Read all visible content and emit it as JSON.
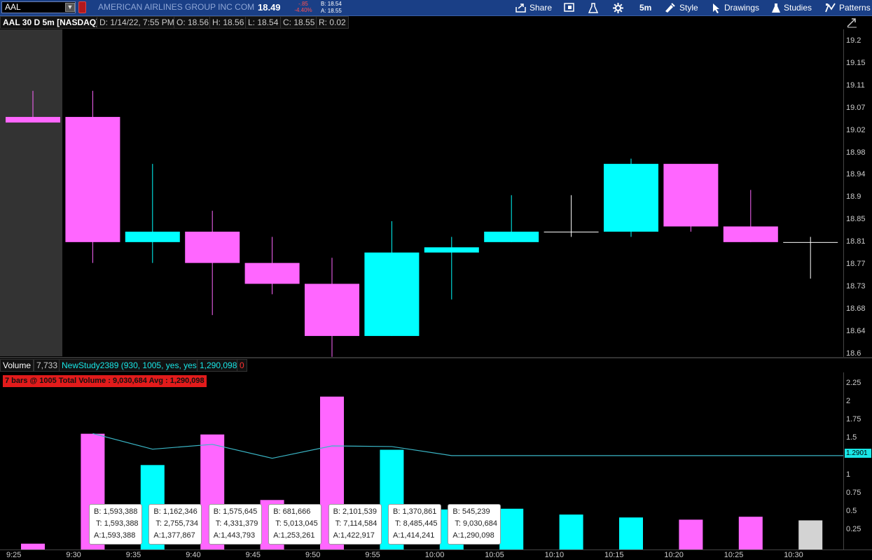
{
  "toolbar": {
    "symbol": "AAL",
    "company": "AMERICAN AIRLINES GROUP INC COM",
    "last": "18.49",
    "net_change": "-.85",
    "pct_change": "-4.40%",
    "bid": "B: 18.54",
    "ask": "A: 18.55",
    "share_label": "Share",
    "timeframe_label": "5m",
    "style_label": "Style",
    "drawings_label": "Drawings",
    "studies_label": "Studies",
    "patterns_label": "Patterns"
  },
  "header": {
    "title": "AAL 30 D 5m [NASDAQ]",
    "date": "D: 1/14/22, 7:55 PM",
    "open": "O: 18.56",
    "high": "H: 18.56",
    "low": "L: 18.54",
    "close": "C: 18.55",
    "range": "R: 0.02"
  },
  "volume_header": {
    "label": "Volume",
    "value": "7,733",
    "study": "NewStudy2389 (930, 1005, yes, yes)",
    "study_value": "1,290,098",
    "zero": "0",
    "banner": "7 bars @ 1005 Total Volume : 9,030,684  Avg : 1,290,098",
    "avg_tag": "1.2901"
  },
  "colors": {
    "up": "#00ffff",
    "down": "#ff66ff",
    "neutral": "#d3d3d3",
    "avg_line": "#3ab5c5"
  },
  "price_axis_labels": [
    "19.2",
    "19.15",
    "19.11",
    "19.07",
    "19.02",
    "18.98",
    "18.94",
    "18.9",
    "18.85",
    "18.81",
    "18.77",
    "18.73",
    "18.68",
    "18.64",
    "18.6"
  ],
  "volume_axis_labels": [
    "2.25",
    "2",
    "1.75",
    "1.5",
    "1.25",
    "1",
    "0.75",
    "0.5",
    "0.25"
  ],
  "time_labels": [
    "9:25",
    "9:30",
    "9:35",
    "9:40",
    "9:45",
    "9:50",
    "9:55",
    "10:00",
    "10:05",
    "10:10",
    "10:15",
    "10:20",
    "10:25",
    "10:30"
  ],
  "tooltips": [
    {
      "b": "B: 1,593,388",
      "t": "T: 1,593,388",
      "a": "A:1,593,388"
    },
    {
      "b": "B: 1,162,346",
      "t": "T: 2,755,734",
      "a": "A:1,377,867"
    },
    {
      "b": "B: 1,575,645",
      "t": "T: 4,331,379",
      "a": "A:1,443,793"
    },
    {
      "b": "B: 681,666",
      "t": "T: 5,013,045",
      "a": "A:1,253,261"
    },
    {
      "b": "B: 2,101,539",
      "t": "T: 7,114,584",
      "a": "A:1,422,917"
    },
    {
      "b": "B: 1,370,861",
      "t": "T: 8,485,445",
      "a": "A:1,414,241"
    },
    {
      "b": "B: 545,239",
      "t": "T: 9,030,684",
      "a": "A:1,290,098"
    }
  ],
  "chart_data": {
    "type": "candlestick",
    "x": [
      "9:25",
      "9:30",
      "9:35",
      "9:40",
      "9:45",
      "9:50",
      "9:55",
      "10:00",
      "10:05",
      "10:10",
      "10:15",
      "10:20",
      "10:25",
      "10:30"
    ],
    "candles": [
      {
        "o": 19.11,
        "h": 19.16,
        "l": 19.1,
        "c": 19.11
      },
      {
        "o": 19.11,
        "h": 19.16,
        "l": 18.83,
        "c": 18.87
      },
      {
        "o": 18.87,
        "h": 19.02,
        "l": 18.83,
        "c": 18.89
      },
      {
        "o": 18.89,
        "h": 18.93,
        "l": 18.73,
        "c": 18.83
      },
      {
        "o": 18.83,
        "h": 18.88,
        "l": 18.77,
        "c": 18.79
      },
      {
        "o": 18.79,
        "h": 18.84,
        "l": 18.65,
        "c": 18.69
      },
      {
        "o": 18.69,
        "h": 18.91,
        "l": 18.69,
        "c": 18.85
      },
      {
        "o": 18.85,
        "h": 18.88,
        "l": 18.76,
        "c": 18.86
      },
      {
        "o": 18.87,
        "h": 18.96,
        "l": 18.87,
        "c": 18.89
      },
      {
        "o": 18.89,
        "h": 18.96,
        "l": 18.88,
        "c": 18.89
      },
      {
        "o": 18.89,
        "h": 19.03,
        "l": 18.88,
        "c": 19.02
      },
      {
        "o": 19.02,
        "h": 19.02,
        "l": 18.89,
        "c": 18.9
      },
      {
        "o": 18.9,
        "h": 18.97,
        "l": 18.87,
        "c": 18.87
      },
      {
        "o": 18.87,
        "h": 18.88,
        "l": 18.8,
        "c": 18.87
      }
    ],
    "volume_millions": [
      0.08,
      1.59,
      1.16,
      1.58,
      0.68,
      2.1,
      1.37,
      0.55,
      0.56,
      0.48,
      0.44,
      0.41,
      0.45,
      0.4
    ],
    "volume_color": [
      "down",
      "down",
      "up",
      "down",
      "down",
      "down",
      "up",
      "up",
      "up",
      "up",
      "up",
      "down",
      "down",
      "neutral"
    ],
    "avg_line_millions": [
      null,
      1.593,
      1.378,
      1.444,
      1.253,
      1.423,
      1.414,
      1.29,
      1.29,
      1.29,
      1.29,
      1.29,
      1.29,
      1.29
    ],
    "price_ylim": [
      18.6,
      19.2
    ],
    "volume_ylim": [
      0,
      2.5
    ]
  }
}
